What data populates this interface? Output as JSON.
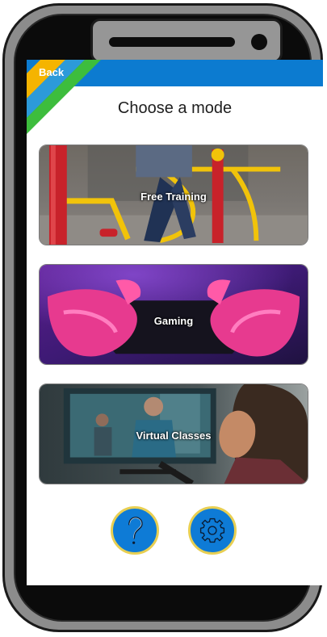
{
  "header": {
    "back_label": "Back",
    "title": "Choose a mode"
  },
  "modes": [
    {
      "label": "Free Training"
    },
    {
      "label": "Gaming"
    },
    {
      "label": "Virtual Classes"
    }
  ],
  "actions": {
    "help_icon": "question-mark-icon",
    "settings_icon": "gear-icon"
  },
  "colors": {
    "topbar": "#0c7bd0",
    "accent_yellow": "#f5b400",
    "accent_green": "#3dbd3d",
    "button_blue": "#0e7bd6",
    "button_ring": "#e8cf52"
  }
}
